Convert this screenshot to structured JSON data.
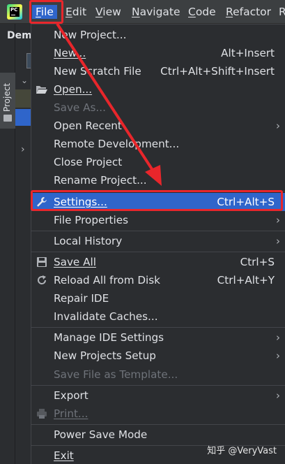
{
  "menubar": {
    "items": [
      {
        "label": "File",
        "mnemonic": "F",
        "rest": "ile"
      },
      {
        "label": "Edit",
        "mnemonic": "E",
        "rest": "dit"
      },
      {
        "label": "View",
        "mnemonic": "V",
        "rest": "iew"
      },
      {
        "label": "Navigate",
        "mnemonic": "N",
        "rest": "avigate"
      },
      {
        "label": "Code",
        "mnemonic": "C",
        "rest": "ode"
      },
      {
        "label": "Refactor",
        "mnemonic": "R",
        "rest": "efactor"
      },
      {
        "label": "R"
      }
    ]
  },
  "sidebar": {
    "project_tab": "Project",
    "project_title": "Dem"
  },
  "file_menu": {
    "items": [
      {
        "label": "New Project...",
        "shortcut": ""
      },
      {
        "label": "New...",
        "shortcut": "Alt+Insert"
      },
      {
        "label": "New Scratch File",
        "shortcut": "Ctrl+Alt+Shift+Insert"
      },
      {
        "label": "Open...",
        "shortcut": ""
      },
      {
        "label": "Save As...",
        "shortcut": ""
      },
      {
        "label": "Open Recent",
        "shortcut": ""
      },
      {
        "label": "Remote Development...",
        "shortcut": ""
      },
      {
        "label": "Close Project",
        "shortcut": ""
      },
      {
        "label": "Rename Project...",
        "shortcut": ""
      },
      {
        "label": "Settings...",
        "shortcut": "Ctrl+Alt+S"
      },
      {
        "label": "File Properties",
        "shortcut": ""
      },
      {
        "label": "Local History",
        "shortcut": ""
      },
      {
        "label": "Save All",
        "shortcut": "Ctrl+S"
      },
      {
        "label": "Reload All from Disk",
        "shortcut": "Ctrl+Alt+Y"
      },
      {
        "label": "Repair IDE",
        "shortcut": ""
      },
      {
        "label": "Invalidate Caches...",
        "shortcut": ""
      },
      {
        "label": "Manage IDE Settings",
        "shortcut": ""
      },
      {
        "label": "New Projects Setup",
        "shortcut": ""
      },
      {
        "label": "Save File as Template...",
        "shortcut": ""
      },
      {
        "label": "Export",
        "shortcut": ""
      },
      {
        "label": "Print...",
        "shortcut": ""
      },
      {
        "label": "Power Save Mode",
        "shortcut": ""
      },
      {
        "label": "Exit",
        "shortcut": ""
      }
    ]
  },
  "watermark": "知乎 @VeryVast",
  "colors": {
    "selection": "#2f65ca",
    "annotation": "#e8262b",
    "background": "#2b2d30"
  },
  "icons": [
    "pycharm-logo-icon",
    "folder-icon",
    "open-folder-icon",
    "wrench-icon",
    "save-icon",
    "reload-icon",
    "print-icon",
    "chevron-right-icon",
    "chevron-down-icon"
  ]
}
